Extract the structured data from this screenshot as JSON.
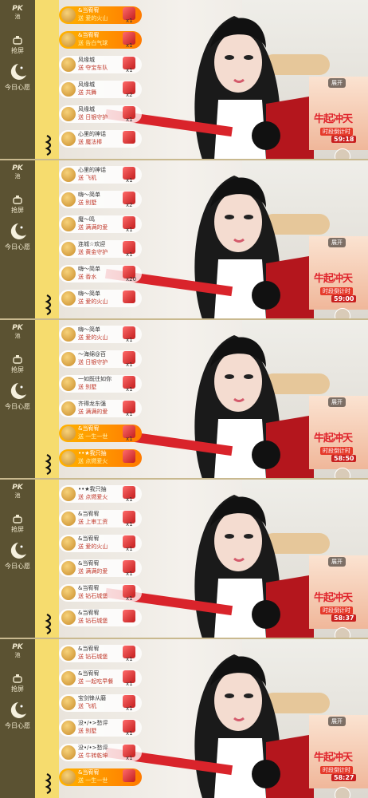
{
  "sidebar": {
    "pk_label": "PK",
    "pk_sub": "池",
    "grab_label": "抢屏",
    "wish_label": "今日心愿"
  },
  "promo": {
    "expand": "展开",
    "title": "牛起冲天",
    "time_label": "时段倒计时"
  },
  "panels": [
    {
      "timer": "59:18",
      "messages": [
        {
          "user": "&当宥宥",
          "gift": "送 爱的火山",
          "count": "x1",
          "hi": true
        },
        {
          "user": "&当宥宥",
          "gift": "送 告白气球",
          "count": "x1",
          "hi": true
        },
        {
          "user": "风缘城",
          "gift": "送 夺宝车队",
          "count": "x1",
          "hi": false
        },
        {
          "user": "风缘城",
          "gift": "送 共舞",
          "count": "x2",
          "hi": false
        },
        {
          "user": "风缘城",
          "gift": "送 日银守护",
          "count": "x1",
          "hi": false
        },
        {
          "user": "心里的神话",
          "gift": "送 魔法棒",
          "count": "",
          "hi": false
        }
      ]
    },
    {
      "timer": "59:00",
      "messages": [
        {
          "user": "心里的神话",
          "gift": "送 飞机",
          "count": "x1",
          "hi": false
        },
        {
          "user": "嗨〜简单",
          "gift": "送 别墅",
          "count": "x2",
          "hi": false
        },
        {
          "user": "魔〜鸣",
          "gift": "送 满满的爱",
          "count": "x1",
          "hi": false
        },
        {
          "user": "连城☆欢迎",
          "gift": "送 黄金守护",
          "count": "x1",
          "hi": false
        },
        {
          "user": "嗨〜简单",
          "gift": "送 香水",
          "count": "x20",
          "hi": false
        },
        {
          "user": "嗨〜简单",
          "gift": "送 爱的火山",
          "count": "",
          "hi": false
        }
      ]
    },
    {
      "timer": "58:50",
      "messages": [
        {
          "user": "嗨〜简单",
          "gift": "送 爱的火山",
          "count": "x1",
          "hi": false
        },
        {
          "user": "〜海绵@百",
          "gift": "送 日银守护",
          "count": "x1",
          "hi": false
        },
        {
          "user": "一如既往如你",
          "gift": "送 别墅",
          "count": "x1",
          "hi": false
        },
        {
          "user": "齐得龙东强",
          "gift": "送 满满的爱",
          "count": "x1",
          "hi": false
        },
        {
          "user": "&当宥宥",
          "gift": "送 一生一世",
          "count": "x1",
          "hi": true
        },
        {
          "user": "••★我只抽",
          "gift": "送 点燃爱火",
          "count": "",
          "hi": true
        }
      ]
    },
    {
      "timer": "58:37",
      "messages": [
        {
          "user": "••★我只抽",
          "gift": "送 点燃爱火",
          "count": "x1",
          "hi": false
        },
        {
          "user": "&当宥宥",
          "gift": "送 上审工资",
          "count": "x1",
          "hi": false
        },
        {
          "user": "&当宥宥",
          "gift": "送 爱的火山",
          "count": "x1",
          "hi": false
        },
        {
          "user": "&当宥宥",
          "gift": "送 满满的爱",
          "count": "x1",
          "hi": false
        },
        {
          "user": "&当宥宥",
          "gift": "送 钻石城堡",
          "count": "x1",
          "hi": false
        },
        {
          "user": "&当宥宥",
          "gift": "送 钻石城堡",
          "count": "",
          "hi": false
        }
      ]
    },
    {
      "timer": "58:27",
      "messages": [
        {
          "user": "&当宥宥",
          "gift": "送 钻石城堡",
          "count": "x1",
          "hi": false
        },
        {
          "user": "&当宥宥",
          "gift": "送 一起吃早餐",
          "count": "x1",
          "hi": false
        },
        {
          "user": "宝剑锋从磨",
          "gift": "送 飞机",
          "count": "x1",
          "hi": false
        },
        {
          "user": "没•/•>愁评",
          "gift": "送 别墅",
          "count": "x1",
          "hi": false
        },
        {
          "user": "没•/•>愁评",
          "gift": "送 牛转乾坤",
          "count": "x1",
          "hi": false
        },
        {
          "user": "&当宥宥",
          "gift": "送 一生一世",
          "count": "",
          "hi": true
        }
      ]
    }
  ]
}
